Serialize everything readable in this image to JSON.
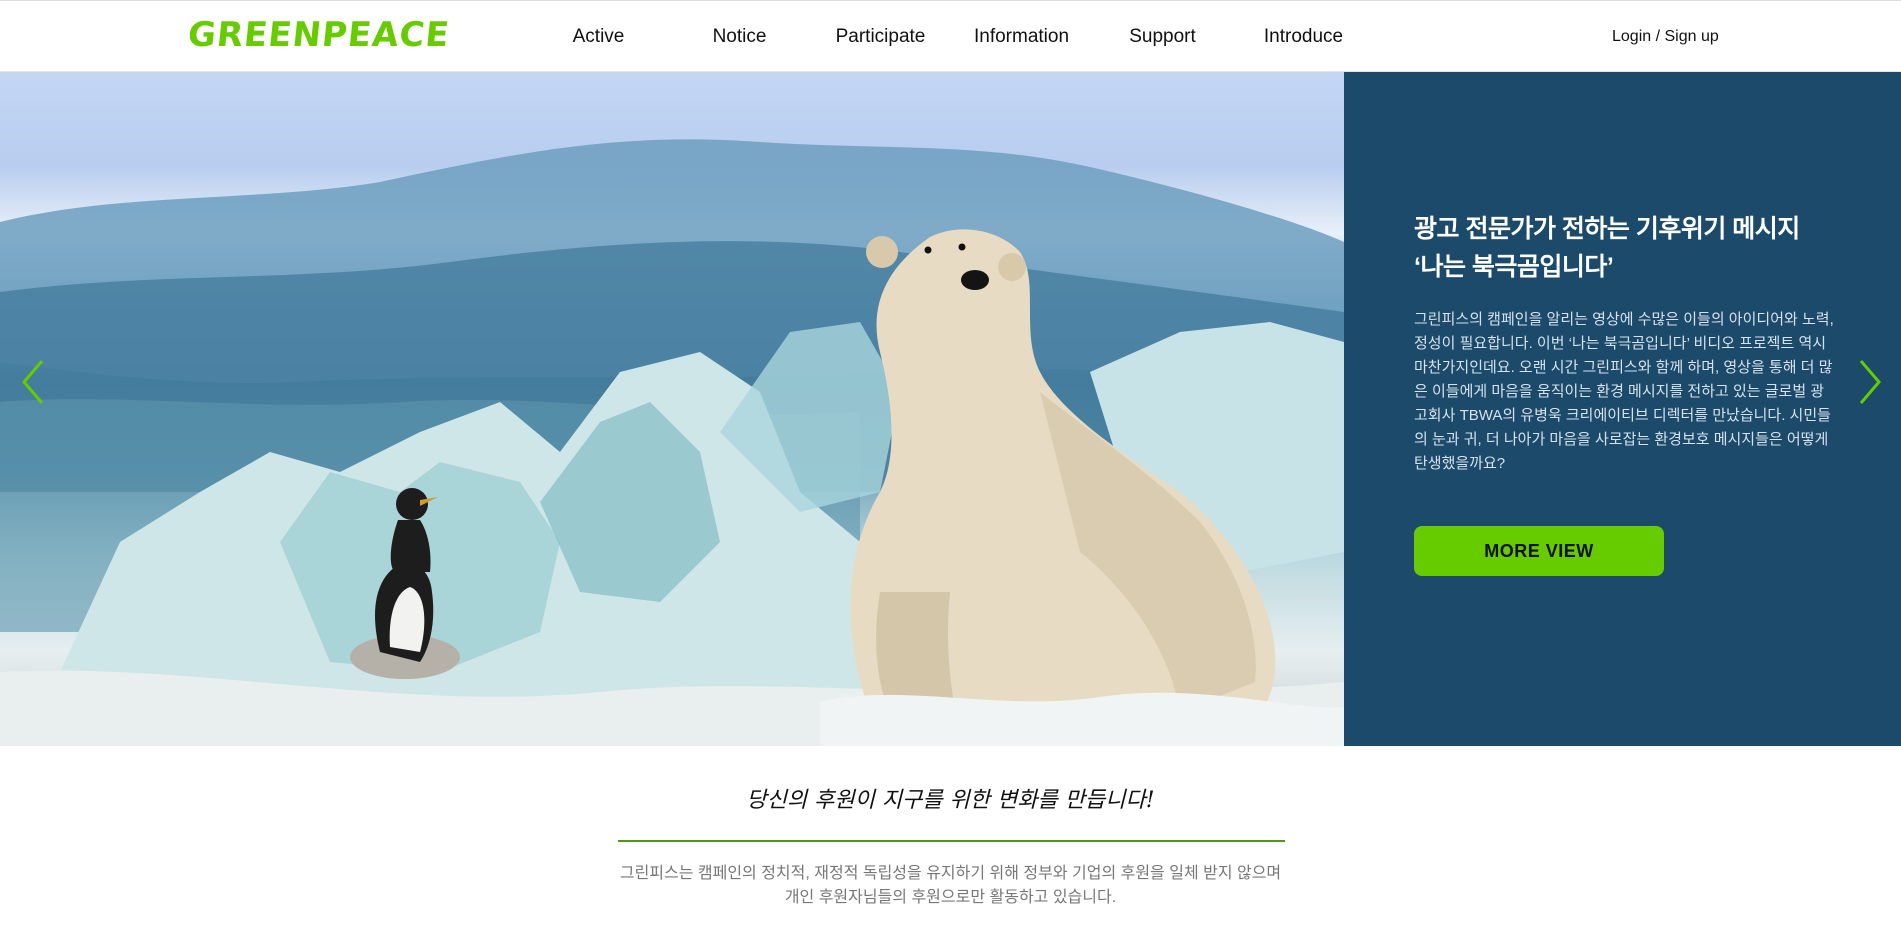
{
  "header": {
    "logo": "GREENPEACE",
    "nav": [
      "Active",
      "Notice",
      "Participate",
      "Information",
      "Support",
      "Introduce"
    ],
    "login": "Login / Sign up"
  },
  "hero": {
    "title_line1": "광고 전문가가 전하는 기후위기 메시지",
    "title_line2": "‘나는 북극곰입니다’",
    "description": "그린피스의 캠페인을 알리는 영상에 수많은 이들의 아이디어와 노력, 정성이 필요합니다. 이번 ‘나는 북극곰입니다’ 비디오 프로젝트 역시 마찬가지인데요. 오랜 시간 그린피스와 함께 하며, 영상을 통해 더 많은 이들에게 마음을 움직이는 환경 메시지를 전하고 있는 글로벌 광고회사 TBWA의 유병욱 크리에이티브 디렉터를 만났습니다. 시민들의 눈과 귀, 더 나아가 마음을 사로잡는 환경보호 메시지들은 어떻게 탄생했을까요?",
    "button": "MORE VIEW",
    "prev_icon": "chevron-left-icon",
    "next_icon": "chevron-right-icon"
  },
  "support": {
    "title": "당신의 후원이 지구를 위한 변화를 만듭니다!",
    "text_line1": "그린피스는 캠페인의 정치적, 재정적 독립성을 유지하기 위해 정부와 기업의 후원을 일체 받지 않으며",
    "text_line2": "개인 후원자님들의 후원으로만 활동하고 있습니다."
  },
  "colors": {
    "brand_green": "#66cc00",
    "panel_blue": "#1c4a6b",
    "divider_green": "#4c9a1a"
  }
}
